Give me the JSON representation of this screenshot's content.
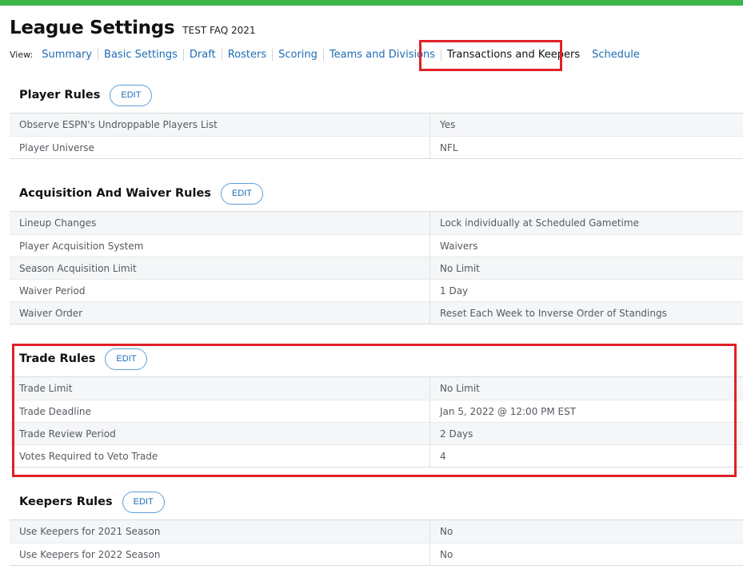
{
  "header": {
    "title": "League Settings",
    "league_name": "TEST FAQ 2021"
  },
  "nav": {
    "view_label": "View:",
    "items": [
      {
        "label": "Summary"
      },
      {
        "label": "Basic Settings"
      },
      {
        "label": "Draft"
      },
      {
        "label": "Rosters"
      },
      {
        "label": "Scoring"
      },
      {
        "label": "Teams and Divisions"
      },
      {
        "label": "Transactions and Keepers"
      },
      {
        "label": "Schedule"
      }
    ],
    "active": "Transactions and Keepers"
  },
  "colors": {
    "accent_green": "#3cb54a",
    "link_blue": "#1f6bb5",
    "highlight_red": "#e02028"
  },
  "sections": [
    {
      "title": "Player Rules",
      "edit_label": "EDIT",
      "rows": [
        {
          "label": "Observe ESPN's Undroppable Players List",
          "value": "Yes"
        },
        {
          "label": "Player Universe",
          "value": "NFL"
        }
      ]
    },
    {
      "title": "Acquisition And Waiver Rules",
      "edit_label": "EDIT",
      "rows": [
        {
          "label": "Lineup Changes",
          "value": "Lock individually at Scheduled Gametime"
        },
        {
          "label": "Player Acquisition System",
          "value": "Waivers"
        },
        {
          "label": "Season Acquisition Limit",
          "value": "No Limit"
        },
        {
          "label": "Waiver Period",
          "value": "1 Day"
        },
        {
          "label": "Waiver Order",
          "value": "Reset Each Week to Inverse Order of Standings"
        }
      ]
    },
    {
      "title": "Trade Rules",
      "edit_label": "EDIT",
      "rows": [
        {
          "label": "Trade Limit",
          "value": "No Limit"
        },
        {
          "label": "Trade Deadline",
          "value": "Jan 5, 2022 @ 12:00 PM EST"
        },
        {
          "label": "Trade Review Period",
          "value": "2 Days"
        },
        {
          "label": "Votes Required to Veto Trade",
          "value": "4"
        }
      ]
    },
    {
      "title": "Keepers Rules",
      "edit_label": "EDIT",
      "rows": [
        {
          "label": "Use Keepers for 2021 Season",
          "value": "No"
        },
        {
          "label": "Use Keepers for 2022 Season",
          "value": "No"
        }
      ]
    }
  ]
}
